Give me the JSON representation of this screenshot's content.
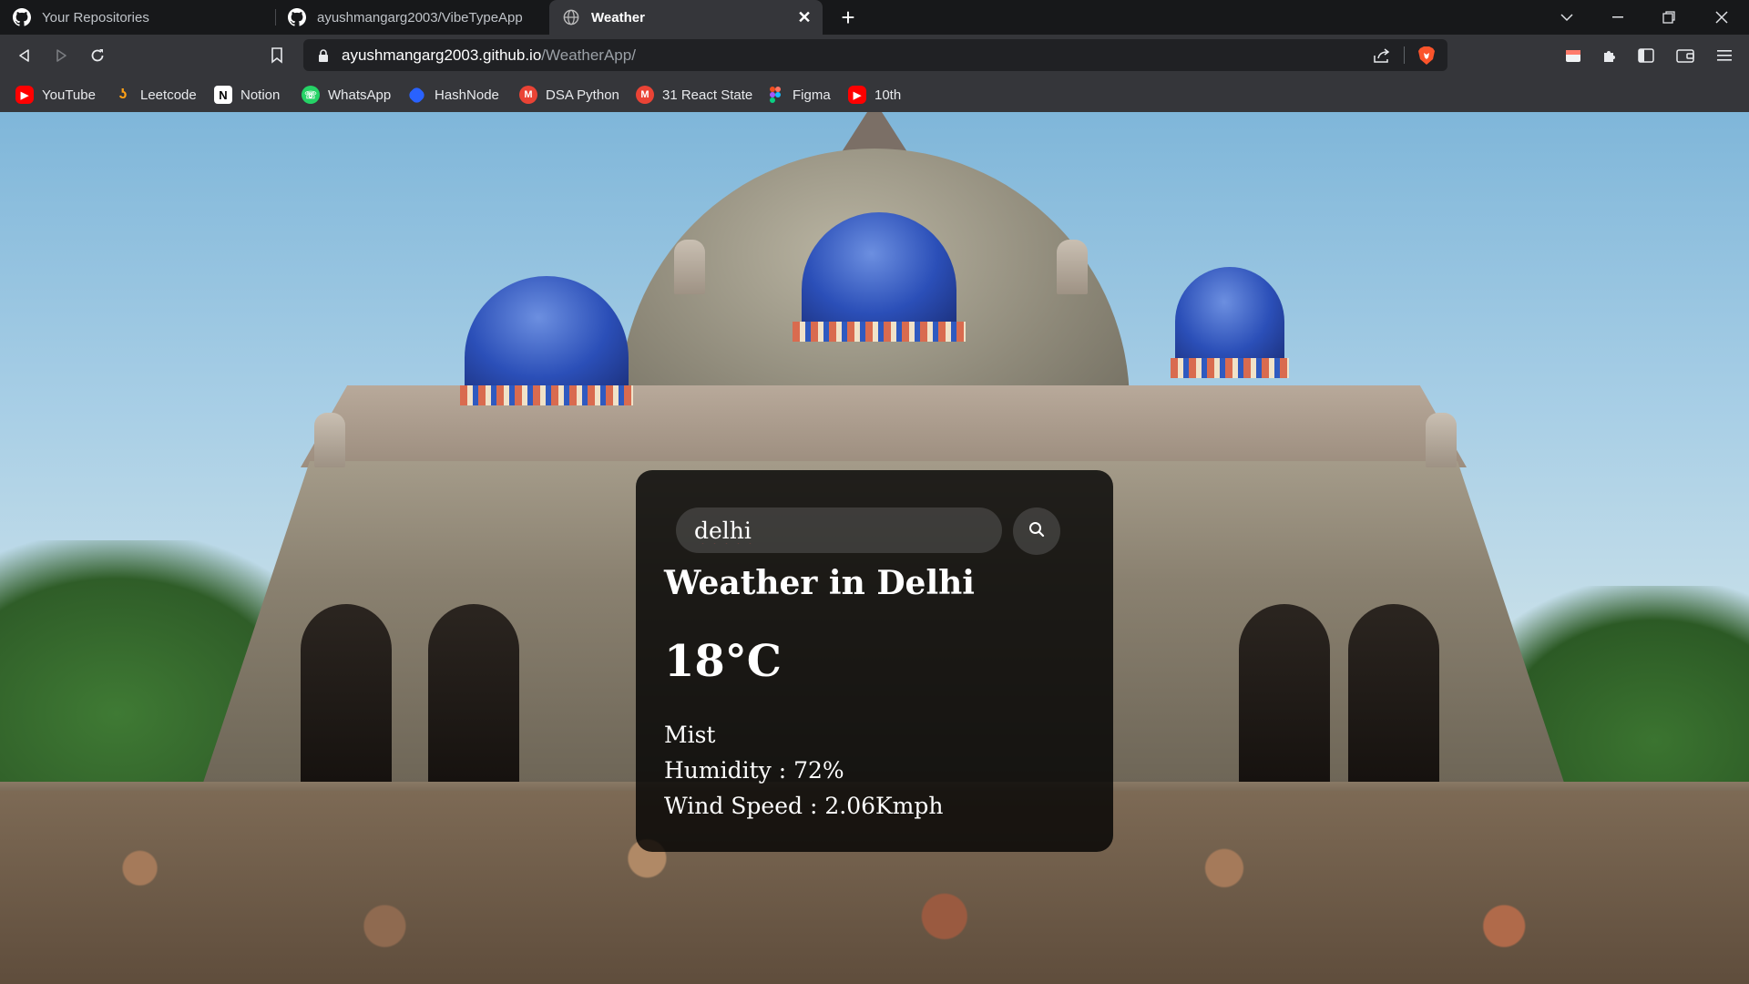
{
  "browser": {
    "tabs": [
      {
        "title": "Your Repositories",
        "icon": "github-icon"
      },
      {
        "title": "ayushmangarg2003/VibeTypeApp",
        "icon": "github-icon"
      },
      {
        "title": "Weather",
        "icon": "globe-icon",
        "active": true
      }
    ],
    "address": {
      "host": "ayushmangarg2003.github.io",
      "path": "/WeatherApp/"
    },
    "bookmarks": [
      {
        "label": "YouTube",
        "icon": "youtube-icon",
        "color": "#ff0000"
      },
      {
        "label": "Leetcode",
        "icon": "leetcode-icon",
        "color": "#ffa116"
      },
      {
        "label": "Notion",
        "icon": "notion-icon",
        "color": "#ffffff"
      },
      {
        "label": "WhatsApp",
        "icon": "whatsapp-icon",
        "color": "#25d366"
      },
      {
        "label": "HashNode",
        "icon": "hashnode-icon",
        "color": "#2962ff"
      },
      {
        "label": "DSA Python",
        "icon": "gmail-icon",
        "color": "#ea4335"
      },
      {
        "label": "31 React State",
        "icon": "gmail-icon",
        "color": "#ea4335"
      },
      {
        "label": "Figma",
        "icon": "figma-icon",
        "color": "#a259ff"
      },
      {
        "label": "10th",
        "icon": "youtube-icon",
        "color": "#ff0000"
      }
    ]
  },
  "weather": {
    "search_value": "delhi",
    "city_heading": "Weather in Delhi",
    "temperature": "18°C",
    "description": "Mist",
    "humidity": "Humidity : 72%",
    "wind": "Wind Speed : 2.06Kmph"
  }
}
